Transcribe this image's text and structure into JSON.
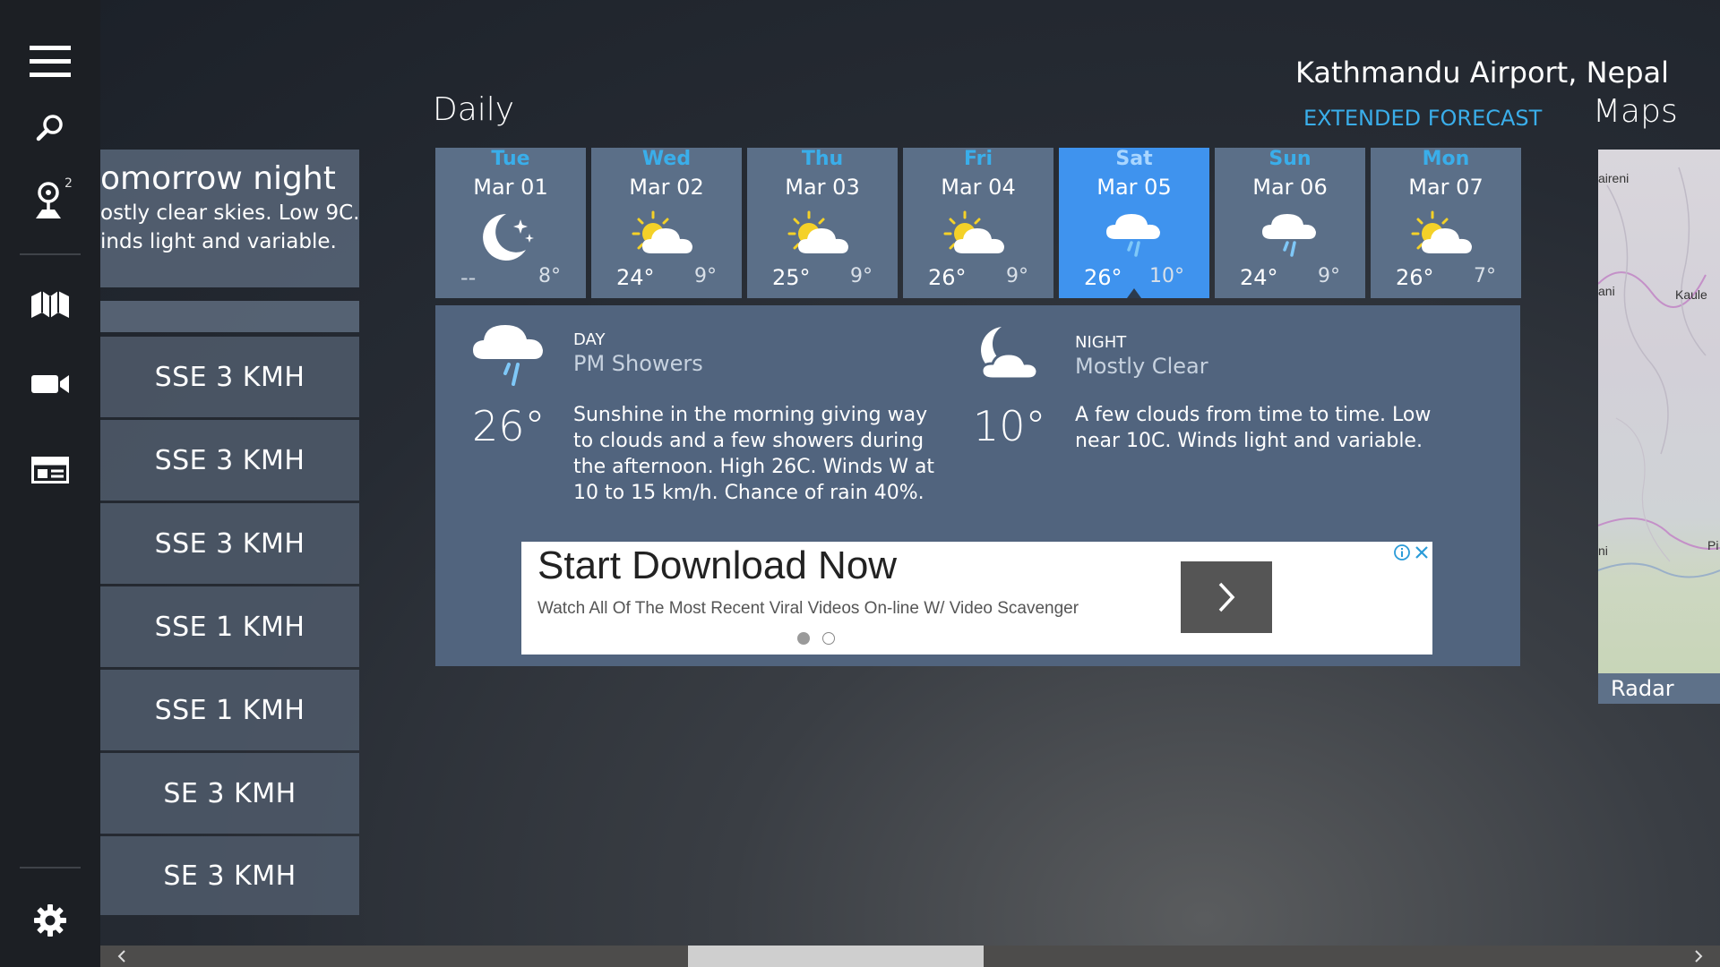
{
  "nav": {
    "favorites_badge": "2",
    "items": [
      "menu-icon",
      "search-icon",
      "location-pin-icon",
      "map-icon",
      "video-icon",
      "news-icon",
      "gear-icon"
    ]
  },
  "hourly": {
    "summary_title": "omorrow night",
    "summary_line1": "ostly clear skies. Low 9C.",
    "summary_line2": "inds light and variable.",
    "winds": [
      "SSE 3 KMH",
      "SSE 3 KMH",
      "SSE 3 KMH",
      "SSE 1 KMH",
      "SSE 1 KMH",
      "SE 3 KMH",
      "SE 3 KMH"
    ]
  },
  "header": {
    "section_title": "Daily",
    "location": "Kathmandu Airport, Nepal",
    "extended_forecast": "EXTENDED FORECAST",
    "maps_title": "Maps"
  },
  "days": [
    {
      "dow": "Tue",
      "date": "Mar 01",
      "hi": "--",
      "lo": "8°",
      "icon": "moon-stars-icon"
    },
    {
      "dow": "Wed",
      "date": "Mar 02",
      "hi": "24°",
      "lo": "9°",
      "icon": "partly-sunny-icon"
    },
    {
      "dow": "Thu",
      "date": "Mar 03",
      "hi": "25°",
      "lo": "9°",
      "icon": "partly-sunny-icon"
    },
    {
      "dow": "Fri",
      "date": "Mar 04",
      "hi": "26°",
      "lo": "9°",
      "icon": "partly-sunny-icon"
    },
    {
      "dow": "Sat",
      "date": "Mar 05",
      "hi": "26°",
      "lo": "10°",
      "icon": "rain-cloud-icon"
    },
    {
      "dow": "Sun",
      "date": "Mar 06",
      "hi": "24°",
      "lo": "9°",
      "icon": "rain-cloud-icon"
    },
    {
      "dow": "Mon",
      "date": "Mar 07",
      "hi": "26°",
      "lo": "7°",
      "icon": "partly-sunny-icon"
    }
  ],
  "selected_day_index": 4,
  "detail": {
    "day_label": "DAY",
    "day_condition": "PM Showers",
    "day_temp": "26°",
    "day_desc": "Sunshine in the morning giving way to clouds and a few showers during the afternoon. High 26C. Winds W at 10 to 15 km/h. Chance of rain 40%.",
    "night_label": "NIGHT",
    "night_condition": "Mostly Clear",
    "night_temp": "10°",
    "night_desc": "A few clouds from time to time. Low near 10C. Winds light and variable."
  },
  "ad": {
    "title": "Start Download Now",
    "subtitle": "Watch All Of The Most Recent Viral Videos On-line W/ Video Scavenger"
  },
  "map": {
    "caption": "Radar",
    "places": [
      "aireni",
      "ani",
      "Kaule",
      "ni",
      "Pi"
    ]
  },
  "colors": {
    "accent": "#3aaeea",
    "tile": "#5b6f88",
    "tile_selected": "#3f93ee",
    "panel": "#51647e",
    "rail": "#1c1f24"
  }
}
